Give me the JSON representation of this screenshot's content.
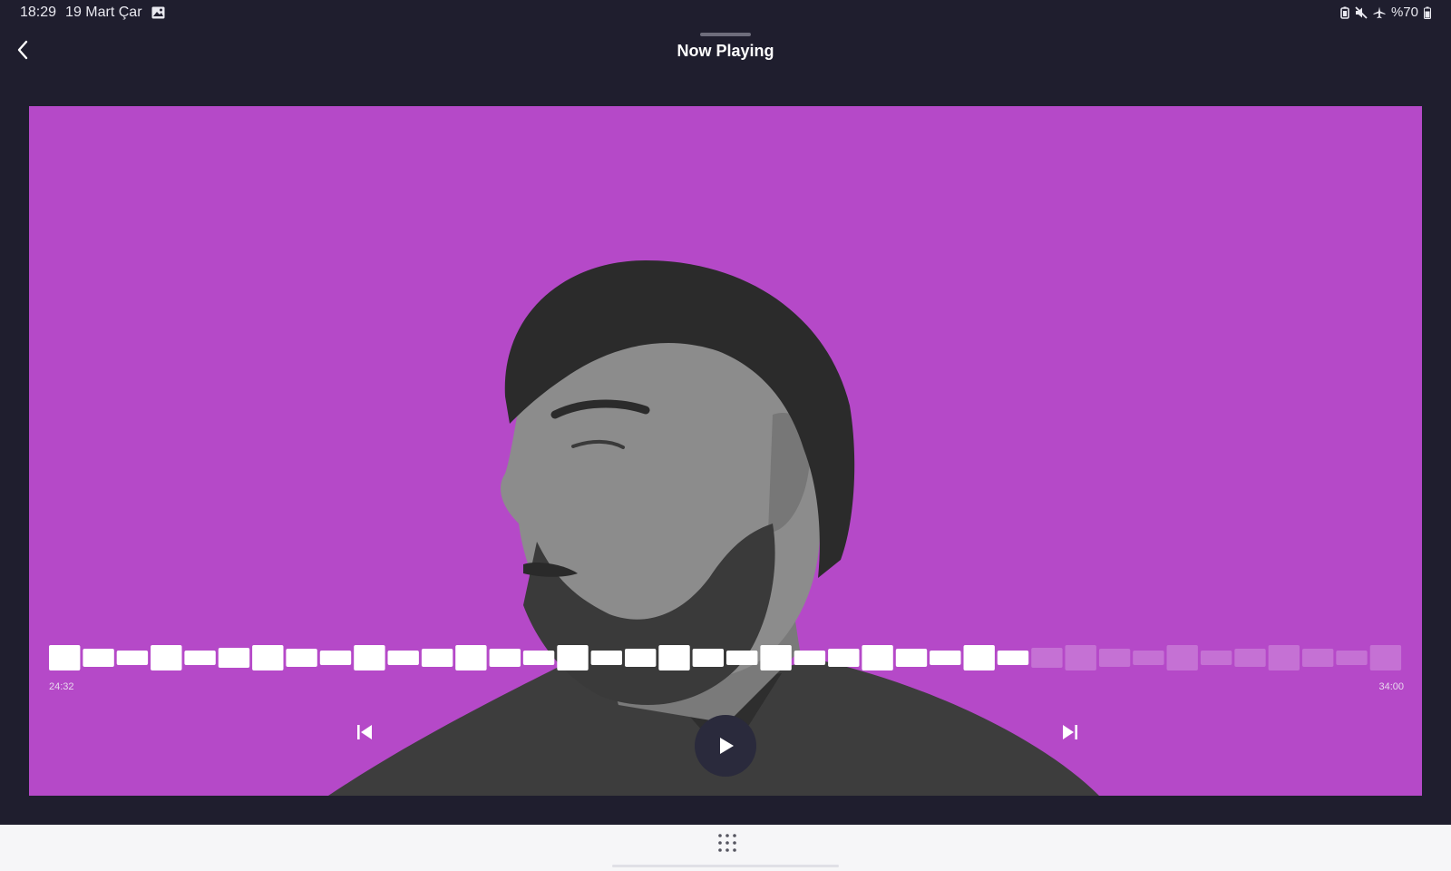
{
  "status_bar": {
    "time": "18:29",
    "date": "19 Mart Çar",
    "battery": "%70",
    "icons": [
      "image-icon",
      "battery-saver-icon",
      "mute-icon",
      "airplane-mode-icon",
      "battery-icon"
    ]
  },
  "header": {
    "title": "Now Playing",
    "back_icon": "chevron-left-icon"
  },
  "player": {
    "background_color": "#b549c8",
    "elapsed": "24:32",
    "total": "34:00",
    "progress": 0.72,
    "play_icon": "play-icon",
    "prev_icon": "skip-previous-icon",
    "next_icon": "skip-next-icon"
  },
  "bottom_bar": {
    "apps_icon": "apps-grid-icon"
  }
}
